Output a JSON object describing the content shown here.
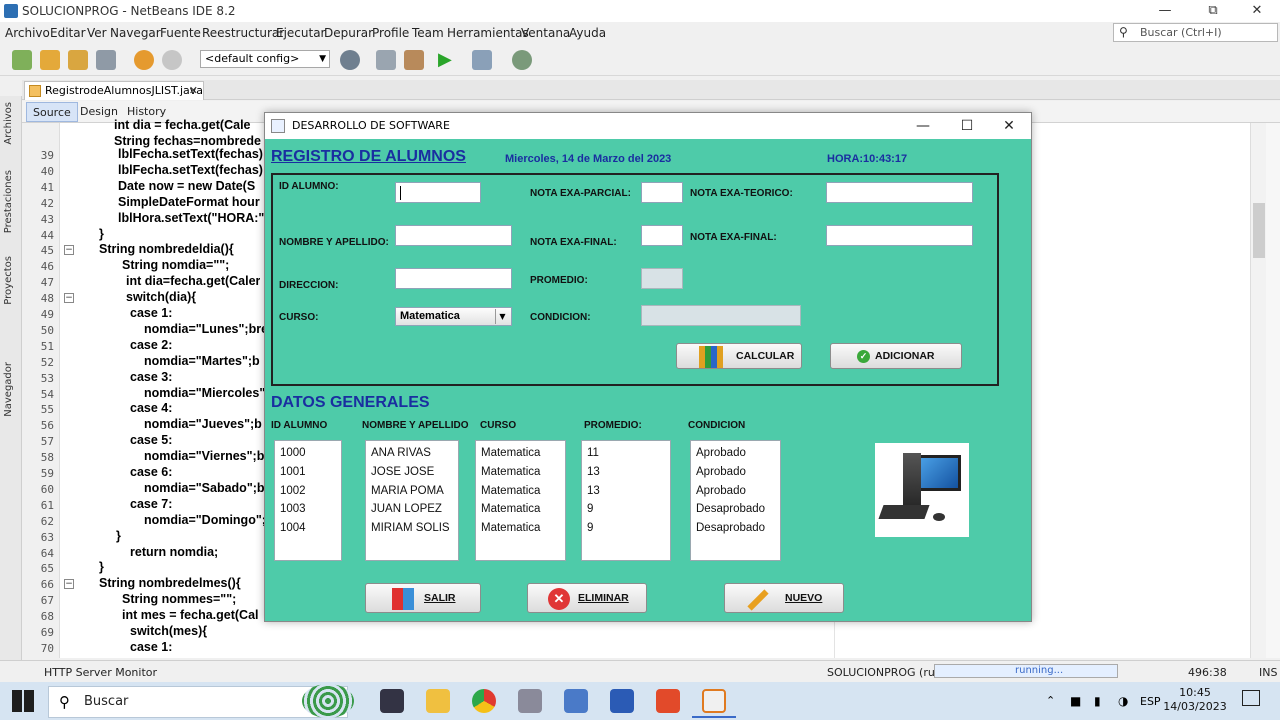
{
  "ide": {
    "window_title": "SOLUCIONPROG - NetBeans IDE 8.2",
    "menu": [
      "Archivo",
      "Editar",
      "Ver",
      "Navegar",
      "Fuente",
      "Reestructurar",
      "Ejecutar",
      "Depurar",
      "Profile",
      "Team",
      "Herramientas",
      "Ventana",
      "Ayuda"
    ],
    "search_placeholder": "Buscar (Ctrl+I)",
    "config": "<default config>",
    "file_tab": "RegistrodeAlumnosJLIST.java",
    "subtabs": [
      "Source",
      "Design",
      "History"
    ],
    "side_labels": [
      "Archivos",
      "Prestaciones",
      "Proyectos",
      "Navegador"
    ],
    "status": {
      "left": "HTTP Server Monitor",
      "project": "SOLUCIONPROG (run)",
      "progress": "running...",
      "position": "496:38",
      "mode": "INS"
    },
    "code": [
      {
        "n": "39",
        "t": "lblFecha.setText(fechas);"
      },
      {
        "n": "40",
        "t": "lblFecha.setText(fechas)"
      },
      {
        "n": "41",
        "t": "Date now = new Date(S"
      },
      {
        "n": "42",
        "t": "SimpleDateFormat hour"
      },
      {
        "n": "43",
        "t": "lblHora.setText(\"HORA:\""
      },
      {
        "n": "44",
        "t": "}"
      },
      {
        "n": "45",
        "t": "String nombredeldia(){"
      },
      {
        "n": "46",
        "t": "String nomdia=\"\";"
      },
      {
        "n": "47",
        "t": "int dia=fecha.get(Caler"
      },
      {
        "n": "48",
        "t": "switch(dia){"
      },
      {
        "n": "49",
        "t": "case 1:"
      },
      {
        "n": "50",
        "t": "nomdia=\"Lunes\";bre"
      },
      {
        "n": "51",
        "t": "case 2:"
      },
      {
        "n": "52",
        "t": "nomdia=\"Martes\";b"
      },
      {
        "n": "53",
        "t": "case 3:"
      },
      {
        "n": "54",
        "t": "nomdia=\"Miercoles\""
      },
      {
        "n": "55",
        "t": "case 4:"
      },
      {
        "n": "56",
        "t": "nomdia=\"Jueves\";b"
      },
      {
        "n": "57",
        "t": "case 5:"
      },
      {
        "n": "58",
        "t": "nomdia=\"Viernes\";b"
      },
      {
        "n": "59",
        "t": "case 6:"
      },
      {
        "n": "60",
        "t": "nomdia=\"Sabado\";b"
      },
      {
        "n": "61",
        "t": "case 7:"
      },
      {
        "n": "62",
        "t": "nomdia=\"Domingo\";"
      },
      {
        "n": "63",
        "t": "}"
      },
      {
        "n": "64",
        "t": "return nomdia;"
      },
      {
        "n": "65",
        "t": "}"
      },
      {
        "n": "66",
        "t": "String nombredelmes(){"
      },
      {
        "n": "67",
        "t": "String nommes=\"\";"
      },
      {
        "n": "68",
        "t": "int mes = fecha.get(Cal"
      },
      {
        "n": "69",
        "t": "switch(mes){"
      },
      {
        "n": "70",
        "t": "case 1:"
      }
    ],
    "code_top_partial": [
      "int dia = fecha.get(Cale",
      "String fechas=nombrede"
    ]
  },
  "dialog": {
    "title": "DESARROLLO DE SOFTWARE",
    "heading": "REGISTRO DE ALUMNOS",
    "date": "Miercoles, 14 de Marzo del 2023",
    "time": "HORA:10:43:17",
    "labels": {
      "id": "ID ALUMNO:",
      "name": "NOMBRE Y APELLIDO:",
      "address": "DIRECCION:",
      "course": "CURSO:",
      "partial": "NOTA EXA-PARCIAL:",
      "final": "NOTA EXA-FINAL:",
      "average": "PROMEDIO:",
      "condition": "CONDICION:",
      "theory": "NOTA EXA-TEORICO:",
      "final2": "NOTA EXA-FINAL:"
    },
    "course_selected": "Matematica",
    "buttons": {
      "calc": "CALCULAR",
      "add": "ADICIONAR",
      "exit": "SALIR",
      "delete": "ELIMINAR",
      "new": "NUEVO"
    },
    "general_title": "DATOS GENERALES",
    "columns": [
      "ID ALUMNO",
      "NOMBRE Y APELLIDO",
      "CURSO",
      "PROMEDIO:",
      "CONDICION"
    ],
    "ids": [
      "1000",
      "1001",
      "1002",
      "1003",
      "1004"
    ],
    "names": [
      "ANA RIVAS",
      "JOSE JOSE",
      "MARIA POMA",
      "JUAN LOPEZ",
      "MIRIAM SOLIS"
    ],
    "courses": [
      "Matematica",
      "Matematica",
      "Matematica",
      "Matematica",
      "Matematica"
    ],
    "averages": [
      "11",
      "13",
      "13",
      "9",
      "9"
    ],
    "conditions": [
      "Aprobado",
      "Aprobado",
      "Aprobado",
      "Desaprobado",
      "Desaprobado"
    ]
  },
  "taskbar": {
    "search": "Buscar",
    "lang": "ESP",
    "time": "10:45",
    "date": "14/03/2023"
  }
}
